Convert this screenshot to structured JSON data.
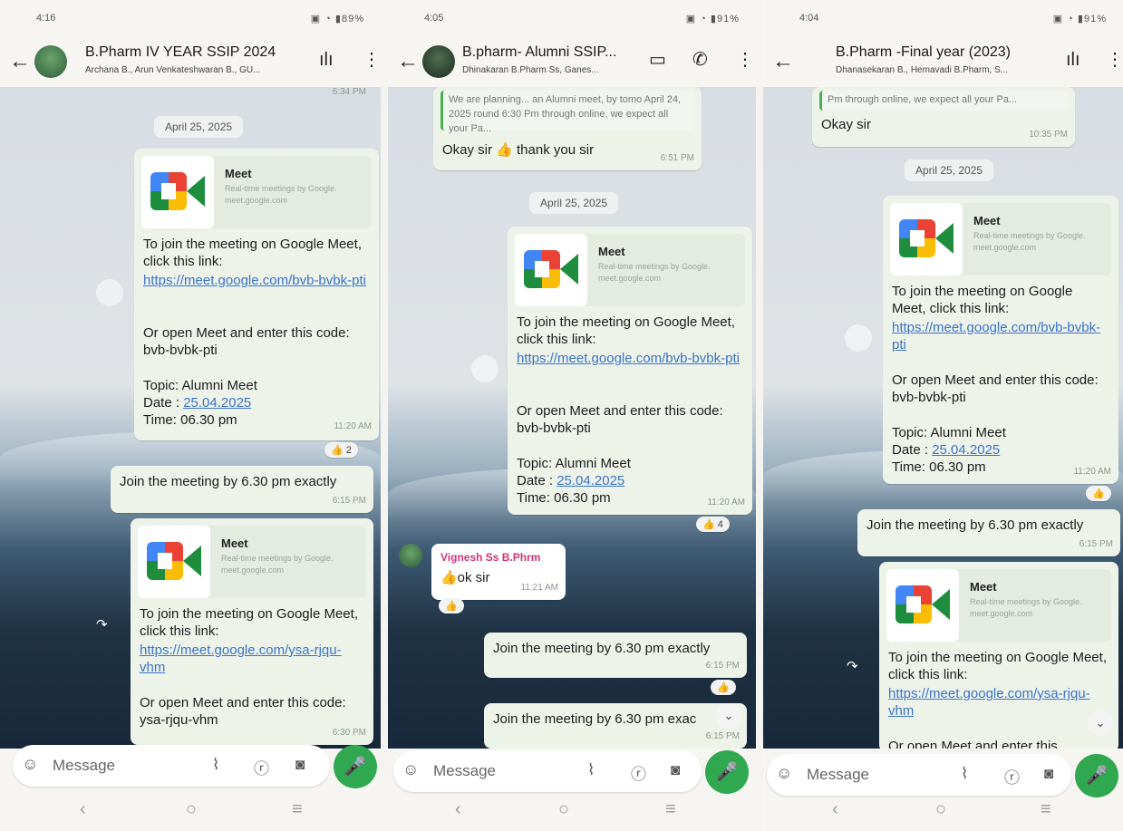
{
  "colors": {
    "accent_green": "#2fa84f",
    "link_blue": "#3b74c9",
    "sender_pink": "#d2337a",
    "bubble_out": "#eef3ea"
  },
  "meet_preview": {
    "title": "Meet",
    "desc": "Real-time meetings by Google. meet.google.com"
  },
  "phones": [
    {
      "status_time": "4:16",
      "status_right": "89%",
      "title": "B.Pharm  IV YEAR SSIP 2024",
      "subtitle": "Archana B., Arun Venkateshwaran B., GU...",
      "prev_time": "6:34 PM",
      "date_chip": "April 25, 2025",
      "msg1": {
        "text_a": "To join the meeting on Google Meet, click this link:",
        "link": "https://meet.google.com/bvb-bvbk-pti",
        "text_b": "Or open Meet and enter this code: bvb-bvbk-pti",
        "text_c": "Topic: Alumni Meet",
        "date_label": "Date : ",
        "date_value": "25.04.2025",
        "time_line": "Time: 06.30 pm",
        "time": "11:20 AM",
        "reaction": "👍 2"
      },
      "msg2": {
        "text": "Join the meeting by 6.30 pm exactly",
        "time": "6:15 PM"
      },
      "msg3": {
        "text_a": "To join the meeting on Google Meet, click this link:",
        "link": "https://meet.google.com/ysa-rjqu-vhm",
        "text_b": "Or open Meet and enter this code: ysa-rjqu-vhm",
        "time": "6:30 PM"
      },
      "input_placeholder": "Message"
    },
    {
      "status_time": "4:05",
      "status_right": "91%",
      "title": "B.pharm- Alumni SSIP...",
      "subtitle": "Dhinakaran B.Pharm Ss, Ganes...",
      "quote_text": "We are planning... an Alumni meet, by tomo April 24, 2025 round 6:30 Pm through online, we expect all your Pa...",
      "reply": {
        "text": "Okay sir 👍 thank you sir",
        "time": "6:51 PM"
      },
      "date_chip": "April 25, 2025",
      "msg1": {
        "text_a": "To join the meeting on Google Meet, click this link:",
        "link": "https://meet.google.com/bvb-bvbk-pti",
        "text_b": "Or open Meet and enter this code: bvb-bvbk-pti",
        "text_c": "Topic: Alumni Meet",
        "date_label": "Date : ",
        "date_value": "25.04.2025",
        "time_line": "Time: 06.30 pm",
        "time": "11:20 AM",
        "reaction": "👍 4"
      },
      "incoming": {
        "sender": "Vignesh Ss B.Phrm",
        "text": "👍ok sir",
        "time": "11:21 AM",
        "reaction": "👍"
      },
      "msg2": {
        "text": "Join the meeting by 6.30 pm exactly",
        "time": "6:15 PM",
        "reaction": "👍"
      },
      "msg3": {
        "text": "Join the meeting by 6.30 pm exac",
        "time": "6:15 PM"
      },
      "input_placeholder": "Message"
    },
    {
      "status_time": "4:04",
      "status_right": "91%",
      "title": "B.Pharm -Final year (2023)",
      "subtitle": "Dhanasekaran B., Hemavadi B.Pharm, S...",
      "quote_text": "Pm through online, we expect all your Pa...",
      "reply": {
        "text": "Okay sir",
        "time": "10:35 PM"
      },
      "date_chip": "April 25, 2025",
      "msg1": {
        "text_a": "To join the meeting on Google Meet, click this link:",
        "link": "https://meet.google.com/bvb-bvbk-pti",
        "text_b": "Or open Meet and enter this code: bvb-bvbk-pti",
        "text_c": "Topic: Alumni Meet",
        "date_label": "Date : ",
        "date_value": "25.04.2025",
        "time_line": "Time: 06.30 pm",
        "time": "11:20 AM",
        "reaction": "👍"
      },
      "msg2": {
        "text": "Join the meeting by 6.30 pm exactly",
        "time": "6:15 PM"
      },
      "msg3": {
        "text_a": "To join the meeting on Google Meet, click this link:",
        "link": "https://meet.google.com/ysa-rjqu-vhm",
        "text_b": "Or open Meet and enter this"
      },
      "input_placeholder": "Message"
    }
  ]
}
